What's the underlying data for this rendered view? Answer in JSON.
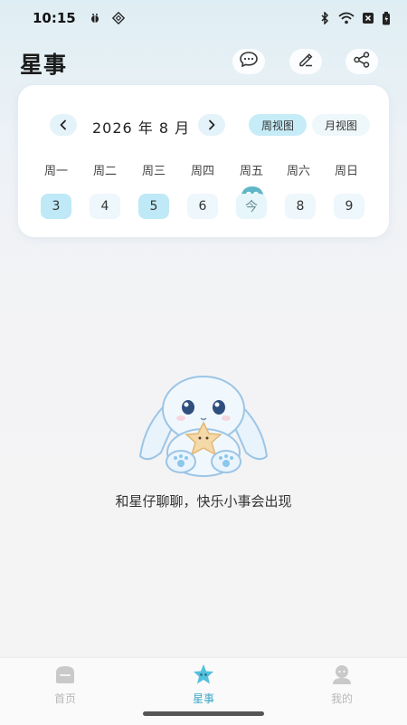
{
  "status_bar": {
    "time": "10:15",
    "icons_left": [
      "bug-icon",
      "app-notification-icon"
    ],
    "icons_right": [
      "bluetooth-icon",
      "wifi-icon",
      "sim-disabled-icon",
      "battery-icon"
    ]
  },
  "header": {
    "title": "星事",
    "buttons": [
      "chat-icon",
      "edit-icon",
      "share-icon"
    ]
  },
  "calendar": {
    "month_label": "2026 年 8 月",
    "views": {
      "week": "周视图",
      "month": "月视图",
      "active": "week"
    },
    "weekdays": [
      "周一",
      "周二",
      "周三",
      "周四",
      "周五",
      "周六",
      "周日"
    ],
    "days": [
      {
        "label": "3",
        "marked": true
      },
      {
        "label": "4",
        "marked": false
      },
      {
        "label": "5",
        "marked": true
      },
      {
        "label": "6",
        "marked": false
      },
      {
        "label": "今",
        "today": true
      },
      {
        "label": "8",
        "marked": false
      },
      {
        "label": "9",
        "marked": false
      }
    ]
  },
  "empty_state": {
    "illustration": "bunny-holding-star",
    "message": "和星仔聊聊，快乐小事会出现"
  },
  "tab_bar": {
    "tabs": [
      {
        "label": "首页",
        "icon": "home-icon",
        "active": false
      },
      {
        "label": "星事",
        "icon": "star-icon",
        "active": true
      },
      {
        "label": "我的",
        "icon": "profile-icon",
        "active": false
      }
    ]
  },
  "colors": {
    "accent": "#3aa7c9",
    "day_marked": "#bfe9f6",
    "view_active": "#c6ecf7"
  }
}
